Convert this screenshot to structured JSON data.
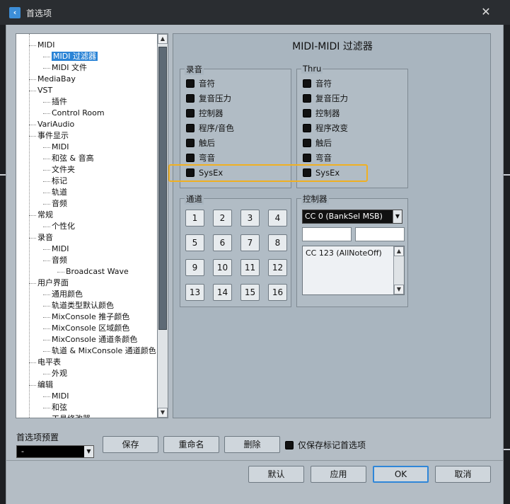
{
  "window": {
    "title": "首选项"
  },
  "tree": {
    "items": [
      {
        "label": "MIDI",
        "level": 1
      },
      {
        "label": "MIDI 过滤器",
        "level": 2,
        "selected": true
      },
      {
        "label": "MIDI 文件",
        "level": 2
      },
      {
        "label": "MediaBay",
        "level": 1
      },
      {
        "label": "VST",
        "level": 1
      },
      {
        "label": "插件",
        "level": 2
      },
      {
        "label": "Control Room",
        "level": 2
      },
      {
        "label": "VariAudio",
        "level": 1
      },
      {
        "label": "事件显示",
        "level": 1
      },
      {
        "label": "MIDI",
        "level": 2
      },
      {
        "label": "和弦 & 音高",
        "level": 2
      },
      {
        "label": "文件夹",
        "level": 2
      },
      {
        "label": "标记",
        "level": 2
      },
      {
        "label": "轨道",
        "level": 2
      },
      {
        "label": "音频",
        "level": 2
      },
      {
        "label": "常规",
        "level": 1
      },
      {
        "label": "个性化",
        "level": 2
      },
      {
        "label": "录音",
        "level": 1
      },
      {
        "label": "MIDI",
        "level": 2
      },
      {
        "label": "音频",
        "level": 2
      },
      {
        "label": "Broadcast Wave",
        "level": 3
      },
      {
        "label": "用户界面",
        "level": 1
      },
      {
        "label": "通用颜色",
        "level": 2
      },
      {
        "label": "轨道类型默认颜色",
        "level": 2
      },
      {
        "label": "MixConsole 推子颜色",
        "level": 2
      },
      {
        "label": "MixConsole 区域颜色",
        "level": 2
      },
      {
        "label": "MixConsole 通道条颜色",
        "level": 2
      },
      {
        "label": "轨道 & MixConsole 通道颜色",
        "level": 2
      },
      {
        "label": "电平表",
        "level": 1
      },
      {
        "label": "外观",
        "level": 2
      },
      {
        "label": "编辑",
        "level": 1
      },
      {
        "label": "MIDI",
        "level": 2
      },
      {
        "label": "和弦",
        "level": 2
      },
      {
        "label": "工具修改器",
        "level": 2
      }
    ]
  },
  "panel": {
    "title": "MIDI-MIDI 过滤器",
    "record": {
      "label": "录音",
      "items": [
        "音符",
        "复音压力",
        "控制器",
        "程序/音色",
        "触后",
        "弯音",
        "SysEx"
      ]
    },
    "thru": {
      "label": "Thru",
      "items": [
        "音符",
        "复音压力",
        "控制器",
        "程序改变",
        "触后",
        "弯音",
        "SysEx"
      ]
    },
    "channels": {
      "label": "通道",
      "buttons": [
        "1",
        "2",
        "3",
        "4",
        "5",
        "6",
        "7",
        "8",
        "9",
        "10",
        "11",
        "12",
        "13",
        "14",
        "15",
        "16"
      ]
    },
    "controller": {
      "label": "控制器",
      "selected": "CC 0 (BankSel MSB)",
      "list": [
        "CC 123 (AllNoteOff)"
      ]
    }
  },
  "bottom": {
    "preset_label": "首选项预置",
    "preset_value": "-",
    "save": "保存",
    "rename": "重命名",
    "delete": "删除",
    "only_marked": "仅保存标记首选项",
    "default": "默认",
    "apply": "应用",
    "ok": "OK",
    "cancel": "取消"
  },
  "colors": {
    "accent": "#2f86d8",
    "highlight": "#f0b022",
    "panel": "#a9b5bf"
  }
}
